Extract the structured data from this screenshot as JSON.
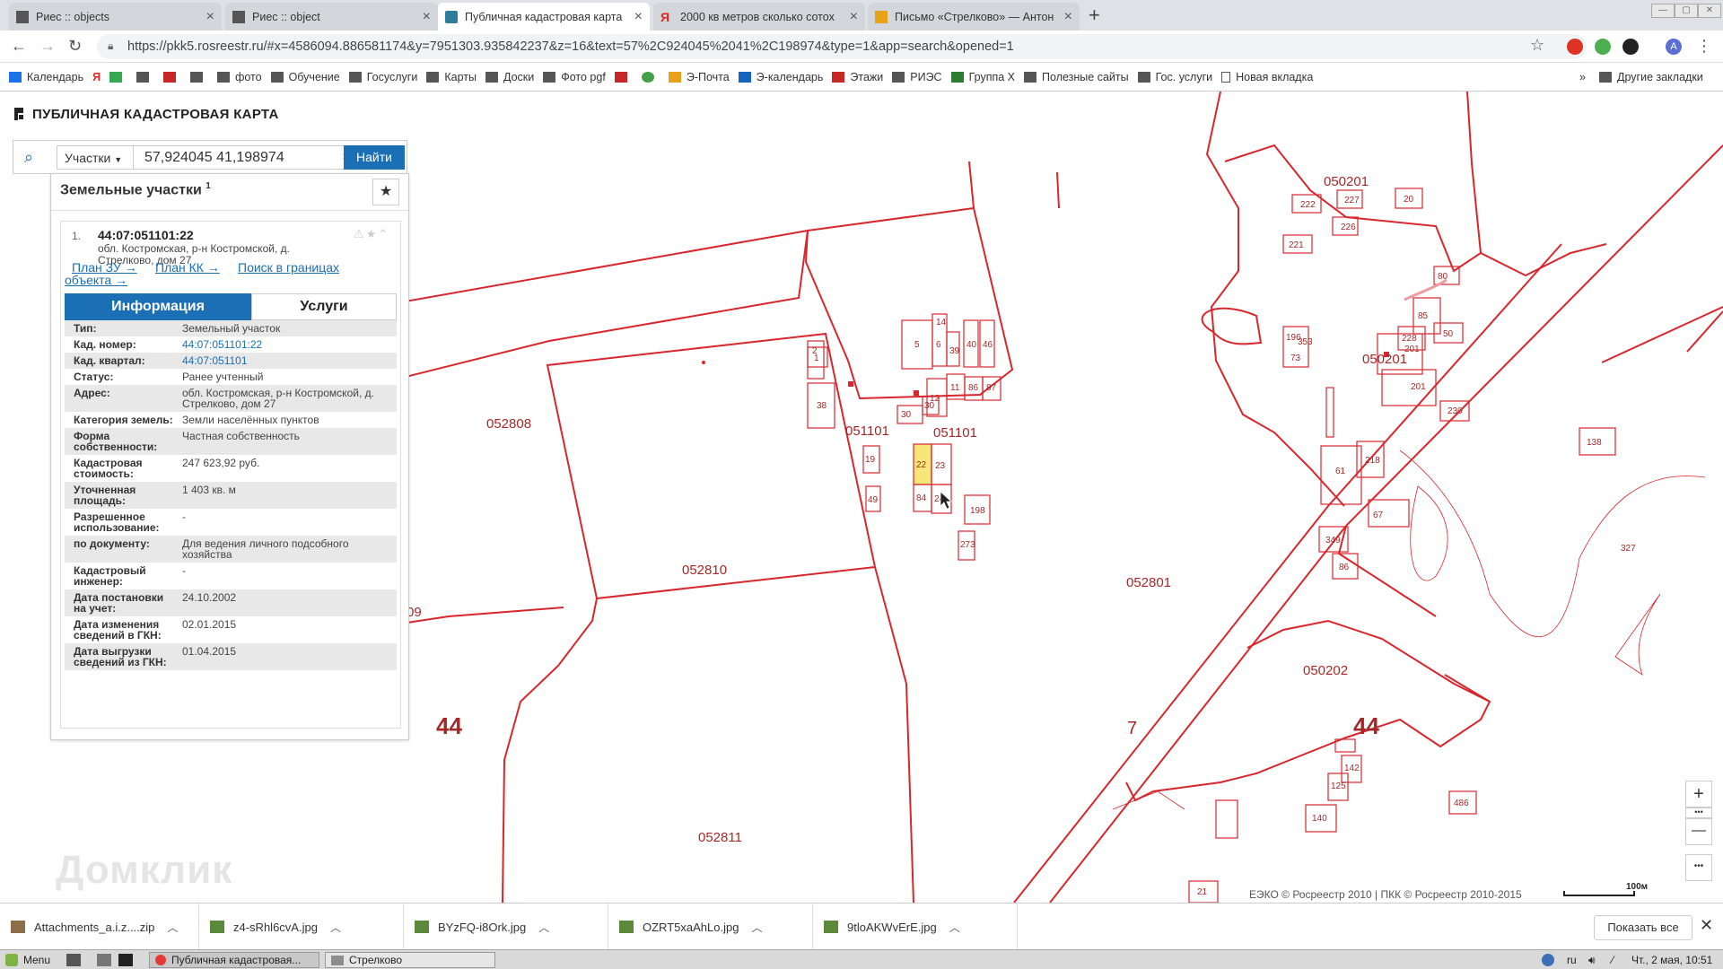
{
  "browser": {
    "tabs": [
      {
        "title": "Риес :: objects",
        "active": false
      },
      {
        "title": "Риес :: object",
        "active": false
      },
      {
        "title": "Публичная кадастровая карта",
        "active": true
      },
      {
        "title": "2000 кв метров сколько сотох",
        "active": false
      },
      {
        "title": "Письмо «Стрелково» — Антон",
        "active": false
      }
    ],
    "url": "https://pkk5.rosreestr.ru/#x=4586094.886581174&y=7951303.935842237&z=16&text=57%2C924045%2041%2C198974&type=1&app=search&opened=1",
    "avatar_letter": "A",
    "bookmarks": [
      "Календарь",
      "фото",
      "Обучение",
      "Госуслуги",
      "Карты",
      "Доски",
      "Фото pgf",
      "Э-Почта",
      "Э-календарь",
      "Этажи",
      "РИЭС",
      "Группа X",
      "Полезные сайты",
      "Гос. услуги",
      "Новая вкладка"
    ],
    "bookmarks_more": "»",
    "other_bookmarks": "Другие закладки"
  },
  "app": {
    "title": "ПУБЛИЧНАЯ КАДАСТРОВАЯ КАРТА",
    "search": {
      "type": "Участки",
      "query": "57,924045 41,198974",
      "button": "Найти"
    },
    "panel": {
      "heading": "Земельные участки",
      "count": "1",
      "item_number": "1.",
      "cad_number": "44:07:051101:22",
      "address": "обл. Костромская, р-н Костромской, д. Стрелково, дом 27",
      "links": {
        "plan_zu": "План ЗУ →",
        "plan_kk": "План КК →",
        "search_bounds_1": "Поиск в границах",
        "search_bounds_2": "объекта →"
      },
      "tab_info": "Информация",
      "tab_services": "Услуги",
      "rows": [
        {
          "k": "Тип:",
          "v": "Земельный участок"
        },
        {
          "k": "Кад. номер:",
          "v": "44:07:051101:22"
        },
        {
          "k": "Кад. квартал:",
          "v": "44:07:051101"
        },
        {
          "k": "Статус:",
          "v": "Ранее учтенный"
        },
        {
          "k": "Адрес:",
          "v": "обл. Костромская, р-н Костромской, д. Стрелково, дом 27"
        },
        {
          "k": "Категория земель:",
          "v": "Земли населённых пунктов"
        },
        {
          "k": "Форма собственности:",
          "v": "Частная собственность"
        },
        {
          "k": "Кадастровая стоимость:",
          "v": "247 623,92 руб."
        },
        {
          "k": "Уточненная площадь:",
          "v": "1 403 кв. м"
        },
        {
          "k": "Разрешенное использование:",
          "v": "-"
        },
        {
          "k": "по документу:",
          "v": "Для ведения личного подсобного хозяйства"
        },
        {
          "k": "Кадастровый инженер:",
          "v": "-"
        },
        {
          "k": "Дата постановки на учет:",
          "v": "24.10.2002"
        },
        {
          "k": "Дата изменения сведений в ГКН:",
          "v": "02.01.2015"
        },
        {
          "k": "Дата выгрузки сведений из ГКН:",
          "v": "01.04.2015"
        }
      ]
    },
    "map": {
      "quarters": [
        "052808",
        "052810",
        "052811",
        "051101",
        "051101",
        "052801",
        "050201",
        "050201",
        "050202",
        "09"
      ],
      "regions": [
        "44",
        "44",
        "7"
      ],
      "parcels": [
        "222",
        "227",
        "226",
        "20",
        "5",
        "14",
        "6",
        "39",
        "40",
        "46",
        "2",
        "1",
        "12",
        "11",
        "86",
        "87",
        "38",
        "30",
        "30",
        "19",
        "22",
        "23",
        "49",
        "84",
        "24",
        "198",
        "273",
        "221",
        "80",
        "85",
        "228",
        "50",
        "196",
        "353",
        "73",
        "201",
        "201",
        "230",
        "61",
        "218",
        "67",
        "349",
        "86",
        "138",
        "327",
        "142",
        "125",
        "140",
        "21",
        "486"
      ],
      "attribution": "ЕЭКО © Росреестр 2010 | ПКК © Росреестр 2010-2015",
      "scale": "100м",
      "zoom_in": "+",
      "zoom_out": "—",
      "more": "•••",
      "watermark": "Домклик",
      "line_color": "#d9262c",
      "highlight_color": "#f7e77a"
    }
  },
  "downloads": {
    "items": [
      "Attachments_a.i.z....zip",
      "z4-sRhl6cvA.jpg",
      "BYzFQ-i8Ork.jpg",
      "OZRT5xaAhLo.jpg",
      "9tloAKWvErE.jpg"
    ],
    "show_all": "Показать все"
  },
  "taskbar": {
    "menu": "Menu",
    "windows": [
      "Публичная кадастровая...",
      "Стрелково"
    ],
    "lang": "ru",
    "clock": "Чт., 2 мая, 10:51"
  }
}
